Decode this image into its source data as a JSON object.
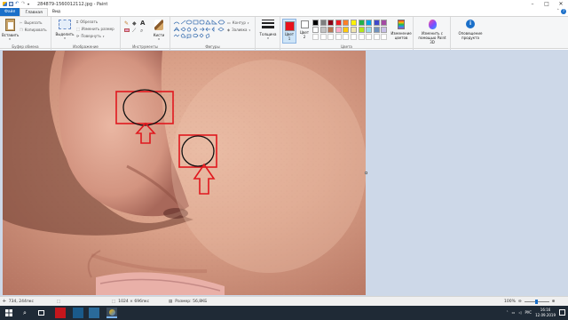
{
  "window": {
    "title": "284879-1560012112.jpg - Paint"
  },
  "tabs": [
    {
      "label": "Файл"
    },
    {
      "label": "Главная"
    },
    {
      "label": "Вид"
    }
  ],
  "ribbon": {
    "clipboard": {
      "paste_label": "Вставить",
      "cut_label": "Вырезать",
      "copy_label": "Копировать",
      "group_label": "Буфер обмена"
    },
    "image": {
      "select_label": "Выделить",
      "crop_label": "Обрезать",
      "resize_label": "Изменить размер",
      "rotate_label": "Повернуть",
      "group_label": "Изображение"
    },
    "tools": {
      "brushes_label": "Кисти",
      "group_label": "Инструменты"
    },
    "shapes": {
      "outline_label": "Контур",
      "fill_label": "Заливка",
      "group_label": "Фигуры"
    },
    "size": {
      "label": "Толщина"
    },
    "colors": {
      "color1_label": "Цвет 1",
      "color2_label": "Цвет 2",
      "edit_label": "Изменение цветов",
      "group_label": "Цвета",
      "color1": "#e8121c",
      "color2": "#ffffff",
      "palette_row1": [
        "#000000",
        "#7f7f7f",
        "#880015",
        "#ed1c24",
        "#ff7f27",
        "#fff200",
        "#22b14c",
        "#00a2e8",
        "#3f48cc",
        "#a349a4"
      ],
      "palette_row2": [
        "#ffffff",
        "#c3c3c3",
        "#b97a57",
        "#ffaec9",
        "#ffc90e",
        "#efe4b0",
        "#b5e61d",
        "#99d9ea",
        "#7092be",
        "#c8bfe7"
      ]
    },
    "paint3d": {
      "label": "Изменить с помощью Paint 3D"
    },
    "alert": {
      "label": "Оповещение продукта"
    }
  },
  "status": {
    "cursor_pos": "734, 244пкс",
    "dimensions": "1024 × 696пкс",
    "file_size": "Размер: 56,8КБ",
    "zoom": "100%"
  },
  "taskbar": {
    "lang": "РУС",
    "time": "16:16",
    "date": "12.09.2019"
  }
}
